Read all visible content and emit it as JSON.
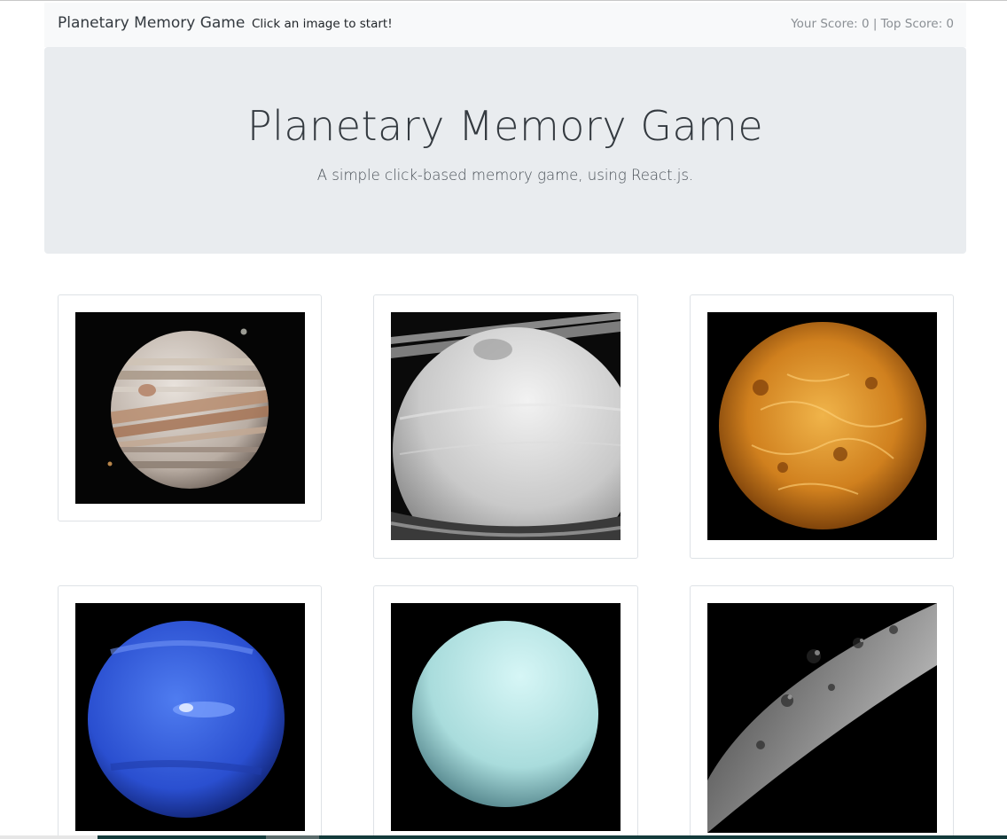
{
  "navbar": {
    "brand": "Planetary Memory Game",
    "status": "Click an image to start!",
    "score_text": "Your Score: 0 | Top Score: 0"
  },
  "jumbotron": {
    "title": "Planetary Memory Game",
    "subtitle": "A simple click-based memory game, using React.js."
  },
  "cards": [
    {
      "planet": "jupiter-image"
    },
    {
      "planet": "saturn-image"
    },
    {
      "planet": "venus-image"
    },
    {
      "planet": "neptune-image"
    },
    {
      "planet": "uranus-image"
    },
    {
      "planet": "mercury-image"
    }
  ]
}
